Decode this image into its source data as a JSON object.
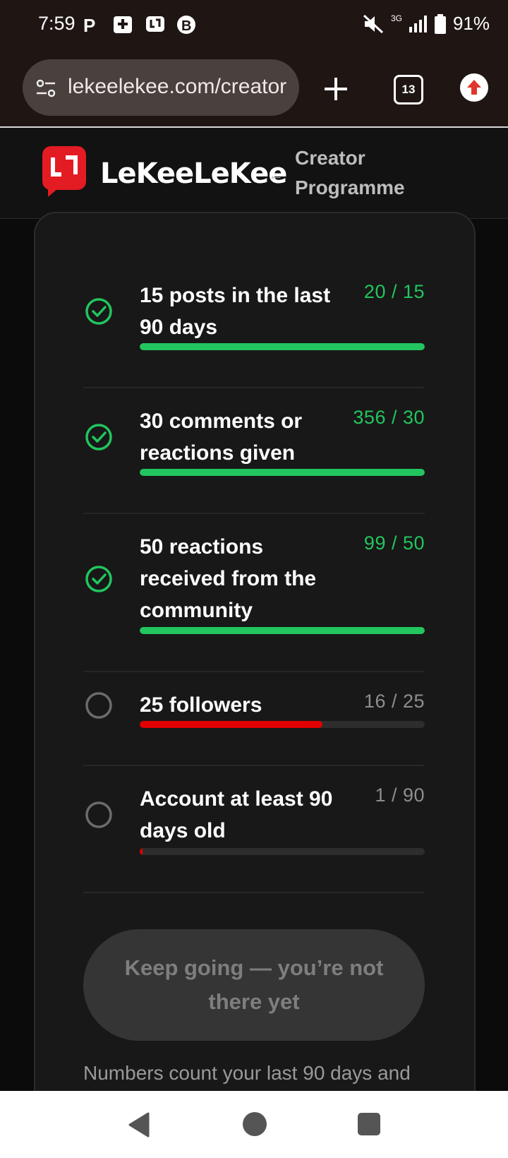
{
  "status_bar": {
    "time": "7:59",
    "network": "3G",
    "battery": "91%",
    "icons": [
      "parking-icon",
      "add-box-icon",
      "lekee-app-icon",
      "bitcoin-icon",
      "mute-icon",
      "signal-icon",
      "battery-icon"
    ]
  },
  "browser": {
    "url": "lekeelekee.com/creator",
    "tab_count": "13"
  },
  "site_header": {
    "logo_text": "LeKeeLeKee",
    "breadcrumb": "Creator Programme"
  },
  "requirements": [
    {
      "label": "15 posts in the last 90 days",
      "count": "20 / 15",
      "met": true,
      "progress": 1.0
    },
    {
      "label": "30 comments or reactions given",
      "count": "356 / 30",
      "met": true,
      "progress": 1.0
    },
    {
      "label": "50 reactions received from the community",
      "count": "99 / 50",
      "met": true,
      "progress": 1.0
    },
    {
      "label": "25 followers",
      "count": "16 / 25",
      "met": false,
      "progress": 0.64
    },
    {
      "label": "Account at least 90 days old",
      "count": "1 / 90",
      "met": false,
      "progress": 0.011
    }
  ],
  "cta_label": "Keep going — you’re not there yet",
  "footnote": "Numbers count your last 90 days and",
  "colors": {
    "accent_green": "#22c55e",
    "accent_red": "#e00000",
    "brand_red": "#e31b23"
  }
}
